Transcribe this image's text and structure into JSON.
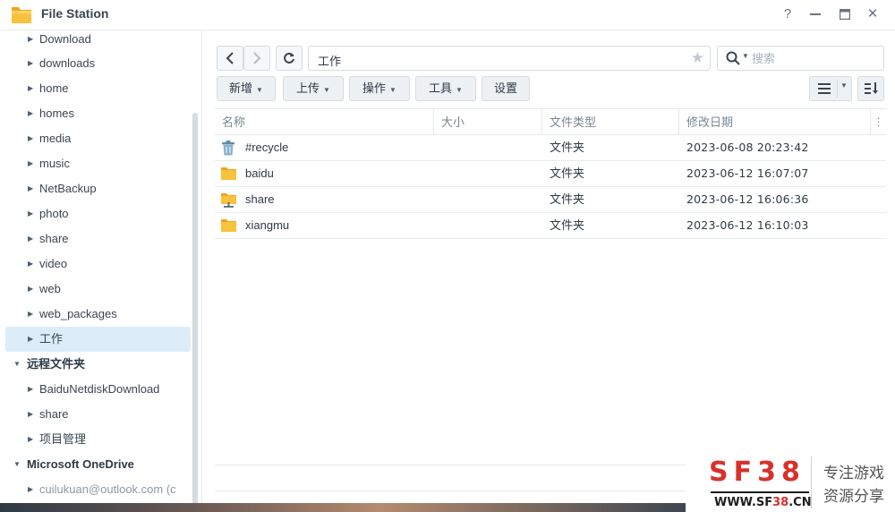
{
  "window": {
    "title": "File Station",
    "controls": [
      "help-icon",
      "minimize-icon",
      "maximize-icon",
      "close-icon"
    ],
    "help_label": "?",
    "minimize_label": "—",
    "maximize_label": "▭",
    "close_label": "✕"
  },
  "sidebar": {
    "items": [
      {
        "label": "Download",
        "icon": "tree-arrow-right"
      },
      {
        "label": "downloads",
        "icon": "tree-arrow-right"
      },
      {
        "label": "home",
        "icon": "tree-arrow-right"
      },
      {
        "label": "homes",
        "icon": "tree-arrow-right"
      },
      {
        "label": "media",
        "icon": "tree-arrow-right"
      },
      {
        "label": "music",
        "icon": "tree-arrow-right"
      },
      {
        "label": "NetBackup",
        "icon": "tree-arrow-right"
      },
      {
        "label": "photo",
        "icon": "tree-arrow-right"
      },
      {
        "label": "share",
        "icon": "tree-arrow-right"
      },
      {
        "label": "video",
        "icon": "tree-arrow-right"
      },
      {
        "label": "web",
        "icon": "tree-arrow-right"
      },
      {
        "label": "web_packages",
        "icon": "tree-arrow-right"
      },
      {
        "label": "工作",
        "icon": "tree-arrow-right",
        "selected": true
      }
    ],
    "remote_group": {
      "label": "远程文件夹",
      "items": [
        {
          "label": "BaiduNetdiskDownload"
        },
        {
          "label": "share"
        },
        {
          "label": "项目管理"
        }
      ]
    },
    "onedrive_group": {
      "label": "Microsoft OneDrive",
      "items": [
        {
          "label": "cuilukuan@outlook.com (c"
        }
      ]
    }
  },
  "toolbar": {
    "path": "工作",
    "search_placeholder": "搜索",
    "buttons": {
      "new": "新增",
      "upload": "上传",
      "action": "操作",
      "tools": "工具",
      "settings": "设置"
    }
  },
  "table": {
    "columns": [
      "名称",
      "大小",
      "文件类型",
      "修改日期"
    ],
    "rows": [
      {
        "name": "#recycle",
        "size": "",
        "type": "文件夹",
        "modified": "2023-06-08 20:23:42",
        "icon": "recycle-bin-icon"
      },
      {
        "name": "baidu",
        "size": "",
        "type": "文件夹",
        "modified": "2023-06-12 16:07:07",
        "icon": "folder-icon"
      },
      {
        "name": "share",
        "size": "",
        "type": "文件夹",
        "modified": "2023-06-12 16:06:36",
        "icon": "shared-folder-icon"
      },
      {
        "name": "xiangmu",
        "size": "",
        "type": "文件夹",
        "modified": "2023-06-12 16:10:03",
        "icon": "folder-icon"
      }
    ]
  },
  "watermark": {
    "logo": "SF38",
    "url_prefix": "WWW.SF",
    "url_mid": "38",
    "url_suffix": ".CN",
    "line1": "专注游戏",
    "line2": "资源分享"
  },
  "colors": {
    "selected_bg": "#dcecf9",
    "folder": "#f9c23c",
    "watermark_red": "#d8312b"
  }
}
